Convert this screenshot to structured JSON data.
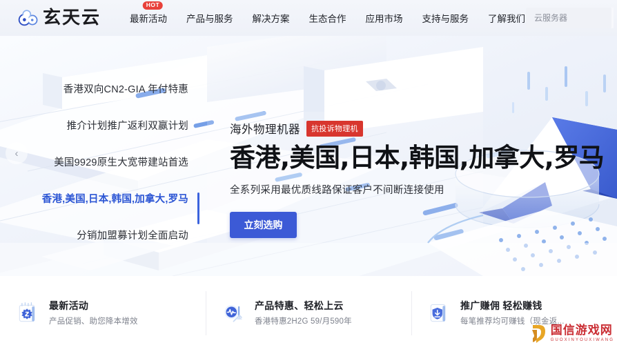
{
  "brand": {
    "logo_text": "玄天云",
    "logo_icon": "cloud-logo-icon"
  },
  "nav": {
    "items": [
      {
        "label": "最新活动",
        "badge": "HOT"
      },
      {
        "label": "产品与服务",
        "badge": ""
      },
      {
        "label": "解决方案",
        "badge": ""
      },
      {
        "label": "生态合作",
        "badge": ""
      },
      {
        "label": "应用市场",
        "badge": ""
      },
      {
        "label": "支持与服务",
        "badge": ""
      },
      {
        "label": "了解我们",
        "badge": ""
      }
    ],
    "more_arrow": "❯"
  },
  "search": {
    "value": "",
    "placeholder": "云服务器",
    "icon": "search-icon"
  },
  "carousel": {
    "prev_arrow": "‹",
    "indicator_count": 4,
    "active_index": 2,
    "side_items": [
      {
        "label": "香港双向CN2-GIA 年付特惠",
        "active": false
      },
      {
        "label": "推介计划推广返利双赢计划",
        "active": false
      },
      {
        "label": "美国9929原生大宽带建站首选",
        "active": false
      },
      {
        "label": "香港,美国,日本,韩国,加拿大,罗马",
        "active": true
      },
      {
        "label": "分销加盟募计划全面启动",
        "active": false
      }
    ]
  },
  "hero": {
    "kicker": "海外物理机器",
    "kicker_badge": "抗投诉物理机",
    "headline": "香港,美国,日本,韩国,加拿大,罗马",
    "subline": "全系列采用最优质线路保证客户不间断连接使用",
    "cta_label": "立刻选购",
    "accent_color": "#3c5ad6",
    "badge_color": "#d8362e"
  },
  "cards": [
    {
      "icon": "calendar-activity-icon",
      "title": "最新活动",
      "desc": "产品促销、助您降本增效"
    },
    {
      "icon": "cloud-pulse-icon",
      "title": "产品特惠、轻松上云",
      "desc": "香港特惠2H2G 59/月590年"
    },
    {
      "icon": "shield-reward-icon",
      "title": "推广赚佣 轻松赚钱",
      "desc": "每笔推荐均可赚钱（现金返..."
    }
  ],
  "watermark": {
    "main": "国信游戏网",
    "sub": "GUOXINYOUXIWANG",
    "color": "#c9272d"
  }
}
